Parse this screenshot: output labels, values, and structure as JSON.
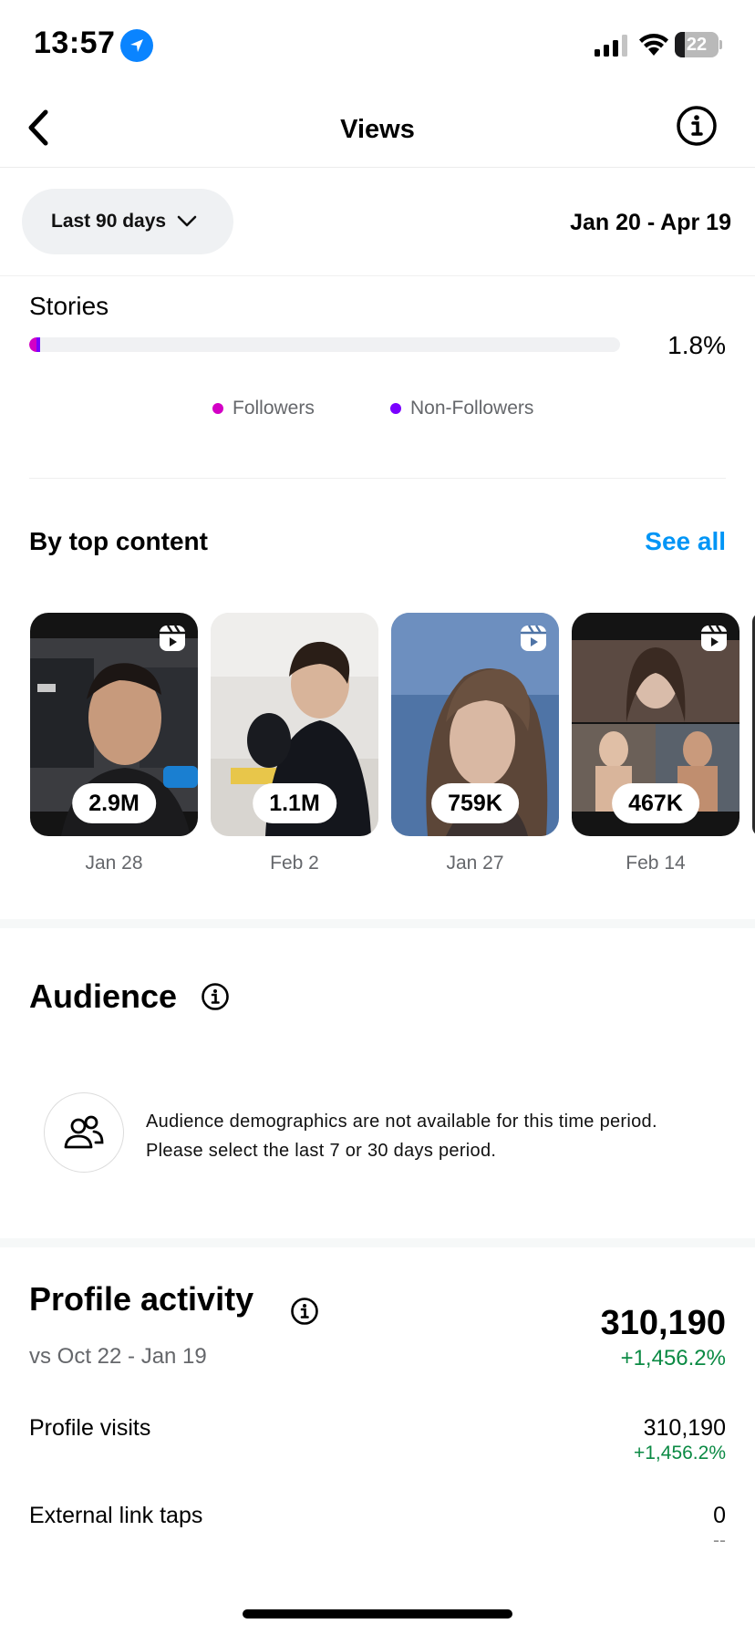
{
  "status_bar": {
    "time": "13:57",
    "battery": "22",
    "battery_level": 0.22
  },
  "header": {
    "title": "Views"
  },
  "filter": {
    "range_label": "Last 90 days",
    "date_range": "Jan 20 - Apr 19"
  },
  "stories": {
    "label": "Stories",
    "percent": "1.8%",
    "followers_share": 1.3,
    "non_followers_share": 0.5,
    "legend": {
      "followers": "Followers",
      "non_followers": "Non-Followers"
    },
    "colors": {
      "followers": "#d300c5",
      "non_followers": "#7a00ff"
    }
  },
  "top_content": {
    "title": "By top content",
    "see_all": "See all",
    "items": [
      {
        "views": "2.9M",
        "date": "Jan 28"
      },
      {
        "views": "1.1M",
        "date": "Feb 2"
      },
      {
        "views": "759K",
        "date": "Jan 27"
      },
      {
        "views": "467K",
        "date": "Feb 14"
      }
    ]
  },
  "audience": {
    "title": "Audience",
    "message": "Audience demographics are not available for this time period. Please select the last 7 or 30 days period."
  },
  "profile_activity": {
    "title": "Profile activity",
    "comparison": "vs Oct 22 - Jan 19",
    "total": "310,190",
    "total_change": "+1,456.2%",
    "rows": [
      {
        "label": "Profile visits",
        "value": "310,190",
        "change": "+1,456.2%"
      },
      {
        "label": "External link taps",
        "value": "0",
        "change": "--"
      }
    ]
  },
  "colors": {
    "accent_link": "#0095f6",
    "positive": "#0b8a44",
    "location": "#0a84ff"
  }
}
